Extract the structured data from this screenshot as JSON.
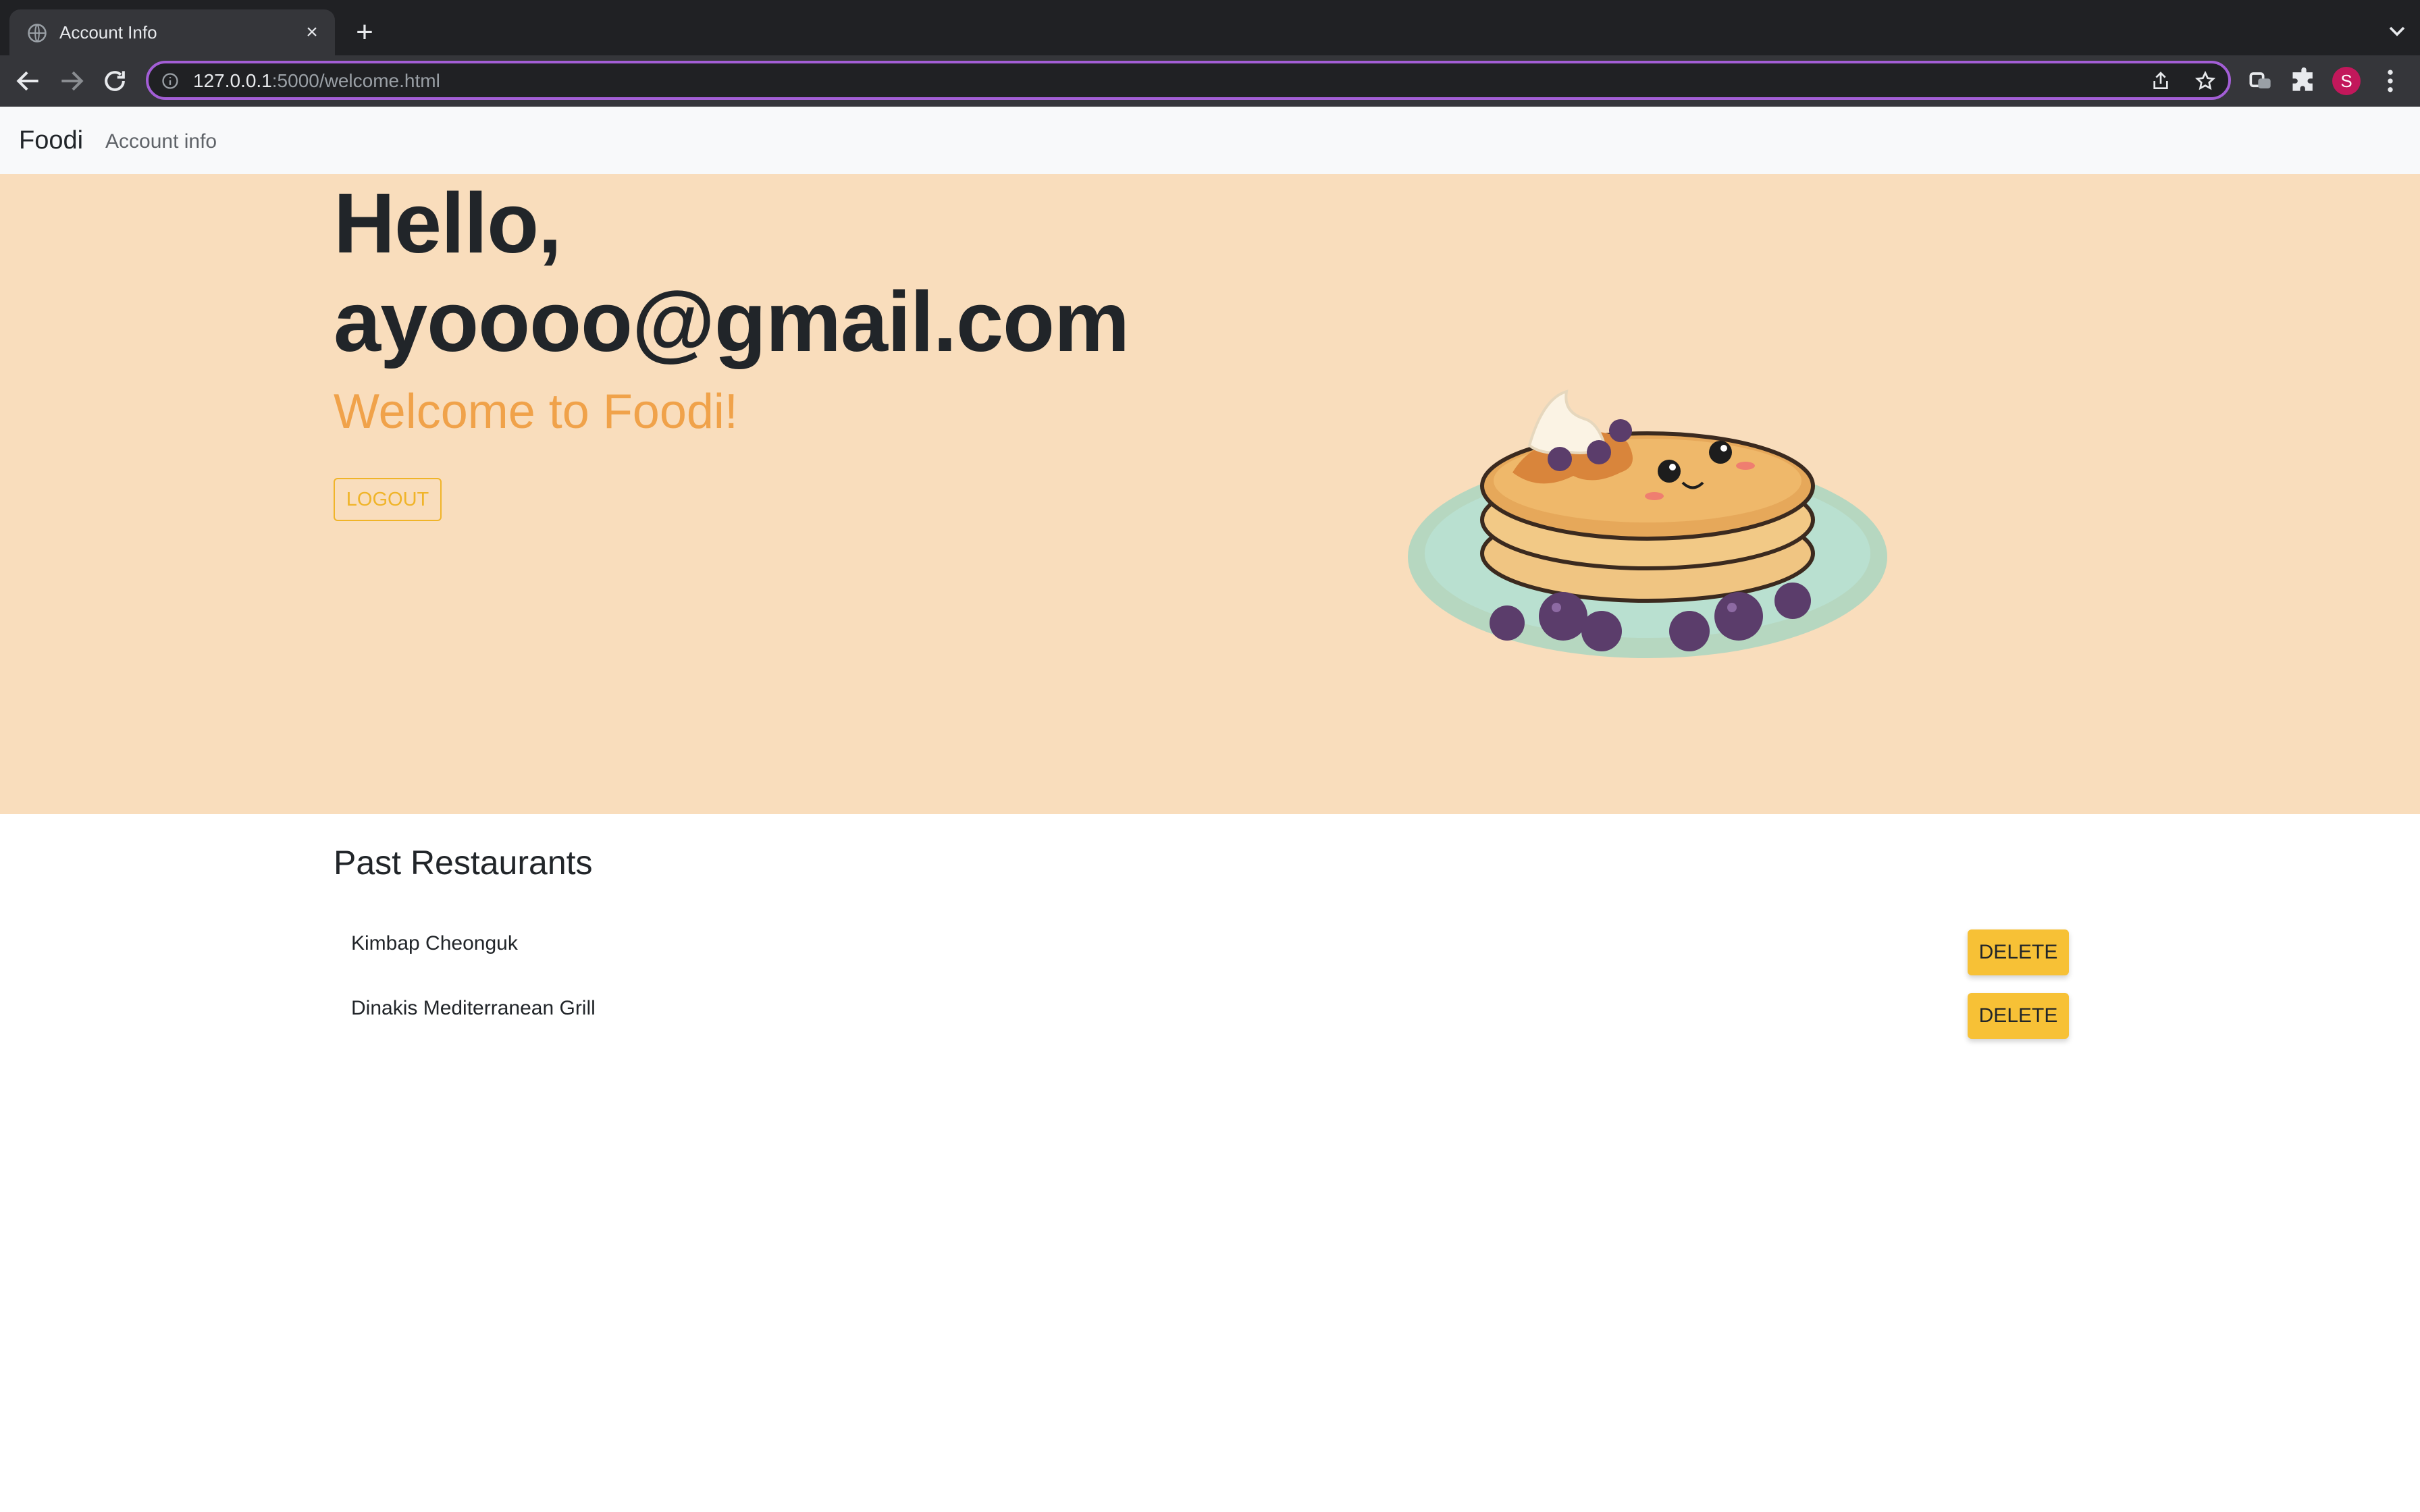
{
  "browser": {
    "tab_title": "Account Info",
    "tab_close": "×",
    "new_tab": "+",
    "url_host": "127.0.0.1",
    "url_rest": ":5000/welcome.html",
    "profile_initial": "S",
    "omnibox_border_color": "#a35ed6"
  },
  "navbar": {
    "brand": "Foodi",
    "link": "Account info"
  },
  "hero": {
    "greeting": "Hello,",
    "email": "ayoooo@gmail.com",
    "welcome": "Welcome to Foodi!",
    "logout_label": "LOGOUT",
    "background_color": "#f9ddbc",
    "accent_color": "#f0a24a"
  },
  "restaurants": {
    "title": "Past Restaurants",
    "delete_label": "DELETE",
    "items": [
      {
        "name": "Kimbap Cheonguk"
      },
      {
        "name": "Dinakis Mediterranean Grill"
      }
    ],
    "button_color": "#f7c136"
  },
  "icons": [
    "globe-icon",
    "close-icon",
    "plus-icon",
    "chevron-down-icon",
    "back-arrow-icon",
    "forward-arrow-icon",
    "reload-icon",
    "info-icon",
    "share-icon",
    "star-icon",
    "extension-icon",
    "puzzle-icon",
    "kebab-menu-icon"
  ]
}
